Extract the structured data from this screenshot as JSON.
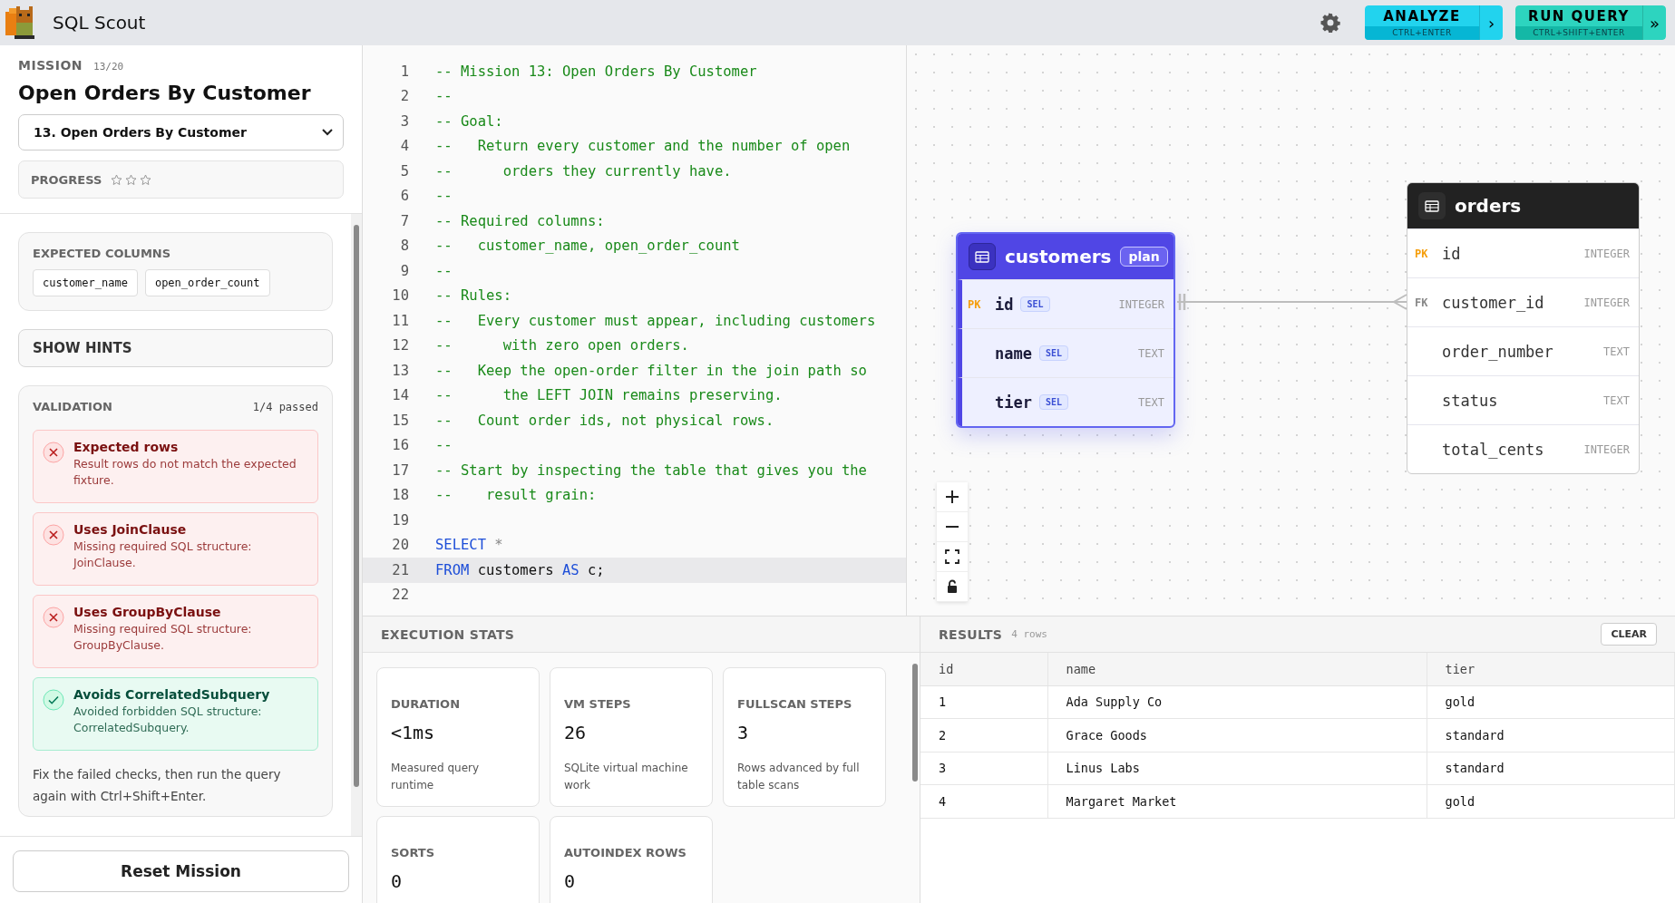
{
  "app": {
    "title": "SQL Scout"
  },
  "toolbar": {
    "buttons": [
      {
        "kind": "analyze",
        "label": "ANALYZE",
        "shortcut": "CTRL+ENTER",
        "arrow": "›"
      },
      {
        "kind": "run",
        "label": "RUN QUERY",
        "shortcut": "CTRL+SHIFT+ENTER",
        "arrow": "»"
      }
    ]
  },
  "mission": {
    "label": "MISSION",
    "counter": "13/20",
    "title": "Open Orders By Customer",
    "selector": "13. Open Orders By Customer",
    "progress": {
      "label": "PROGRESS",
      "stars": 0
    }
  },
  "expected_columns": {
    "title": "EXPECTED COLUMNS",
    "columns": [
      "customer_name",
      "open_order_count"
    ]
  },
  "hints_button": "SHOW HINTS",
  "validation": {
    "title": "VALIDATION",
    "summary": "1/4 passed",
    "checks": [
      {
        "title": "Expected rows",
        "message": "Result rows do not match the expected fixture.",
        "passed": false
      },
      {
        "title": "Uses JoinClause",
        "message": "Missing required SQL structure: JoinClause.",
        "passed": false
      },
      {
        "title": "Uses GroupByClause",
        "message": "Missing required SQL structure: GroupByClause.",
        "passed": false
      },
      {
        "title": "Avoids CorrelatedSubquery",
        "message": "Avoided forbidden SQL structure: CorrelatedSubquery.",
        "passed": true
      }
    ],
    "note": "Fix the failed checks, then run the query again with Ctrl+Shift+Enter."
  },
  "reset_button": "Reset Mission",
  "editor": {
    "lines": [
      {
        "number": "1",
        "selected": false,
        "tokens": [
          {
            "text": "-- Mission 13: Open Orders By Customer",
            "kind": "comment"
          }
        ]
      },
      {
        "number": "2",
        "selected": false,
        "tokens": [
          {
            "text": "--",
            "kind": "comment"
          }
        ]
      },
      {
        "number": "3",
        "selected": false,
        "tokens": [
          {
            "text": "-- Goal:",
            "kind": "comment"
          }
        ]
      },
      {
        "number": "4",
        "selected": false,
        "tokens": [
          {
            "text": "--   Return every customer and the number of open",
            "kind": "comment"
          }
        ]
      },
      {
        "number": "5",
        "selected": false,
        "tokens": [
          {
            "text": "--      orders they currently have.",
            "kind": "comment"
          }
        ]
      },
      {
        "number": "6",
        "selected": false,
        "tokens": [
          {
            "text": "--",
            "kind": "comment"
          }
        ]
      },
      {
        "number": "7",
        "selected": false,
        "tokens": [
          {
            "text": "-- Required columns:",
            "kind": "comment"
          }
        ]
      },
      {
        "number": "8",
        "selected": false,
        "tokens": [
          {
            "text": "--   customer_name, open_order_count",
            "kind": "comment"
          }
        ]
      },
      {
        "number": "9",
        "selected": false,
        "tokens": [
          {
            "text": "--",
            "kind": "comment"
          }
        ]
      },
      {
        "number": "10",
        "selected": false,
        "tokens": [
          {
            "text": "-- Rules:",
            "kind": "comment"
          }
        ]
      },
      {
        "number": "11",
        "selected": false,
        "tokens": [
          {
            "text": "--   Every customer must appear, including customers",
            "kind": "comment"
          }
        ]
      },
      {
        "number": "12",
        "selected": false,
        "tokens": [
          {
            "text": "--      with zero open orders.",
            "kind": "comment"
          }
        ]
      },
      {
        "number": "13",
        "selected": false,
        "tokens": [
          {
            "text": "--   Keep the open-order filter in the join path so",
            "kind": "comment"
          }
        ]
      },
      {
        "number": "14",
        "selected": false,
        "tokens": [
          {
            "text": "--      the LEFT JOIN remains preserving.",
            "kind": "comment"
          }
        ]
      },
      {
        "number": "15",
        "selected": false,
        "tokens": [
          {
            "text": "--   Count order ids, not physical rows.",
            "kind": "comment"
          }
        ]
      },
      {
        "number": "16",
        "selected": false,
        "tokens": [
          {
            "text": "--",
            "kind": "comment"
          }
        ]
      },
      {
        "number": "17",
        "selected": false,
        "tokens": [
          {
            "text": "-- Start by inspecting the table that gives you the",
            "kind": "comment"
          }
        ]
      },
      {
        "number": "18",
        "selected": false,
        "tokens": [
          {
            "text": "--    result grain:",
            "kind": "comment"
          }
        ]
      },
      {
        "number": "19",
        "selected": false
      },
      {
        "number": "20",
        "selected": false,
        "tokens": [
          {
            "text": "SELECT",
            "kind": "keyword"
          },
          {
            "text": " *",
            "kind": "operator"
          }
        ]
      },
      {
        "number": "21",
        "selected": true,
        "tokens": [
          {
            "text": "FROM",
            "kind": "keyword"
          },
          {
            "text": " customers ",
            "kind": "plain"
          },
          {
            "text": "AS",
            "kind": "keyword"
          },
          {
            "text": " c;",
            "kind": "plain"
          }
        ]
      },
      {
        "number": "22",
        "selected": false
      }
    ]
  },
  "schema": {
    "tables": [
      {
        "name": "customers",
        "selected": true,
        "badge": "plan",
        "columns": [
          {
            "kind": "primary",
            "key": "PK",
            "name": "id",
            "tag": "SEL",
            "type": "INTEGER"
          },
          {
            "kind": "plain",
            "name": "name",
            "tag": "SEL",
            "type": "TEXT"
          },
          {
            "kind": "plain",
            "name": "tier",
            "tag": "SEL",
            "type": "TEXT"
          }
        ]
      },
      {
        "name": "orders",
        "selected": false,
        "columns": [
          {
            "kind": "primary",
            "key": "PK",
            "name": "id",
            "type": "INTEGER"
          },
          {
            "kind": "foreign",
            "key": "FK",
            "name": "customer_id",
            "type": "INTEGER"
          },
          {
            "kind": "plain",
            "name": "order_number",
            "type": "TEXT"
          },
          {
            "kind": "plain",
            "name": "status",
            "type": "TEXT"
          },
          {
            "kind": "plain",
            "name": "total_cents",
            "type": "INTEGER"
          }
        ]
      }
    ]
  },
  "stats": {
    "title": "EXECUTION STATS",
    "cards": [
      {
        "label": "DURATION",
        "value": "<1ms",
        "description": "Measured query runtime"
      },
      {
        "label": "VM STEPS",
        "value": "26",
        "description": "SQLite virtual machine work"
      },
      {
        "label": "FULLSCAN STEPS",
        "value": "3",
        "description": "Rows advanced by full table scans"
      },
      {
        "label": "SORTS",
        "value": "0"
      },
      {
        "label": "AUTOINDEX ROWS",
        "value": "0"
      }
    ]
  },
  "results": {
    "title": "RESULTS",
    "count": "4 rows",
    "clear_button": "CLEAR",
    "columns": [
      "id",
      "name",
      "tier"
    ],
    "rows": [
      [
        "1",
        "Ada Supply Co",
        "gold"
      ],
      [
        "2",
        "Grace Goods",
        "standard"
      ],
      [
        "3",
        "Linus Labs",
        "standard"
      ],
      [
        "4",
        "Margaret Market",
        "gold"
      ]
    ]
  }
}
